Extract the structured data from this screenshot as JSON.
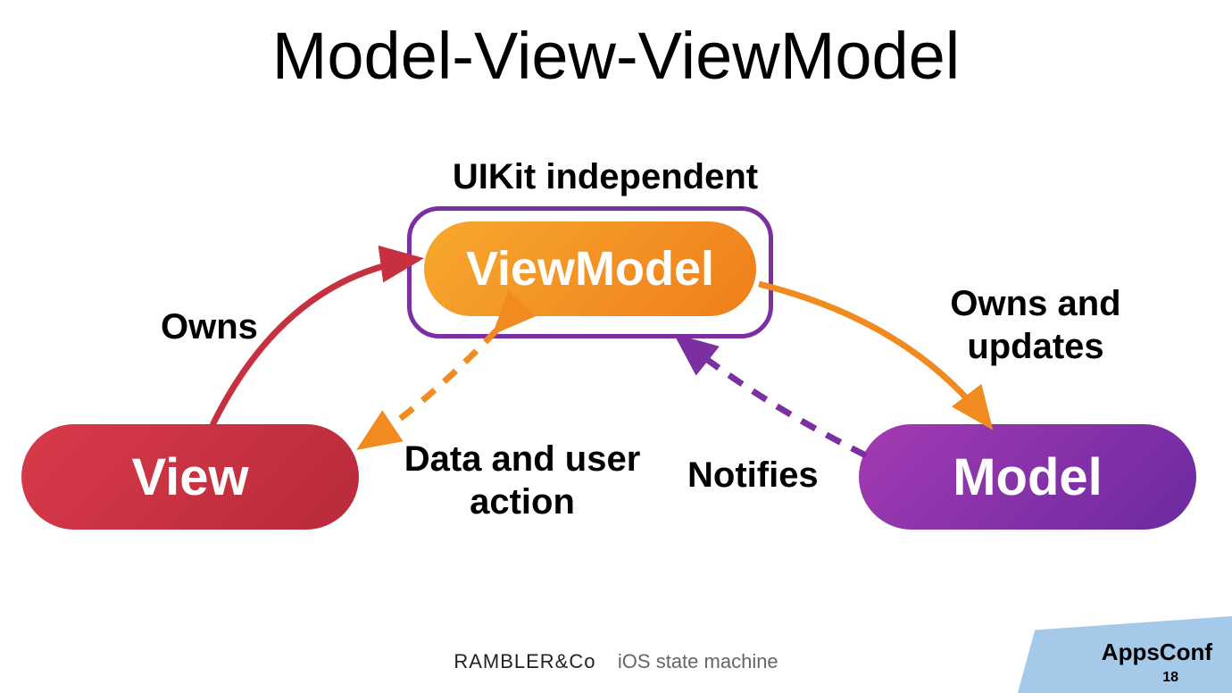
{
  "title": "Model-View-ViewModel",
  "nodes": {
    "view": "View",
    "viewmodel": "ViewModel",
    "model": "Model"
  },
  "annotations": {
    "uikit": "UIKit independent",
    "owns": "Owns",
    "data_user_action": "Data and user action",
    "notifies": "Notifies",
    "owns_updates": "Owns and updates"
  },
  "footer": {
    "brand": "RAMBLER&Co",
    "subtitle": "iOS state machine",
    "conference": "AppsConf",
    "page": "18"
  },
  "colors": {
    "view": "#c7303f",
    "viewmodel": "#f18a1f",
    "model": "#7b2fa0",
    "arrow_red": "#c7303f",
    "arrow_orange": "#f18a1f",
    "arrow_purple": "#7b2fa0"
  },
  "edges": [
    {
      "from": "View",
      "to": "ViewModel",
      "label": "Owns",
      "style": "solid",
      "color": "#c7303f"
    },
    {
      "from": "ViewModel",
      "to": "View",
      "label": "Data and user action",
      "style": "dashed",
      "color": "#f18a1f"
    },
    {
      "from": "ViewModel",
      "to": "Model",
      "label": "Owns and updates",
      "style": "solid",
      "color": "#f18a1f"
    },
    {
      "from": "Model",
      "to": "ViewModel",
      "label": "Notifies",
      "style": "dashed",
      "color": "#7b2fa0"
    }
  ]
}
